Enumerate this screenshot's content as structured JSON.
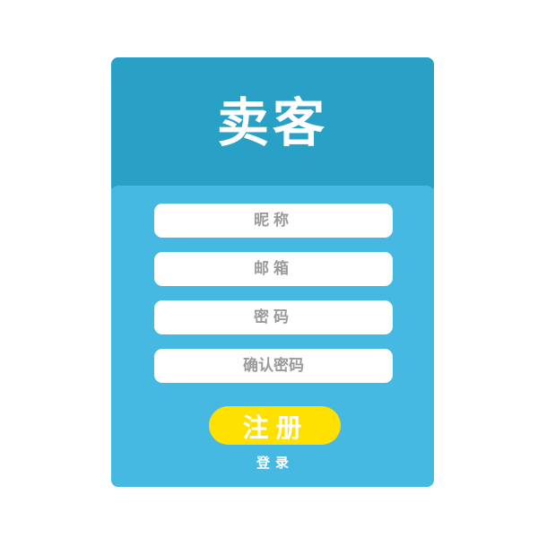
{
  "header": {
    "title": "卖客"
  },
  "form": {
    "nickname_placeholder": "昵称",
    "email_placeholder": "邮箱",
    "password_placeholder": "密码",
    "confirm_password_placeholder": "确认密码",
    "register_label": "注册",
    "login_label": "登录"
  },
  "colors": {
    "header_background": "#29a1c7",
    "body_background": "#46b9e2",
    "button_background": "#ffe100",
    "field_background": "#ffffff",
    "placeholder_text": "#9a9a9a"
  }
}
